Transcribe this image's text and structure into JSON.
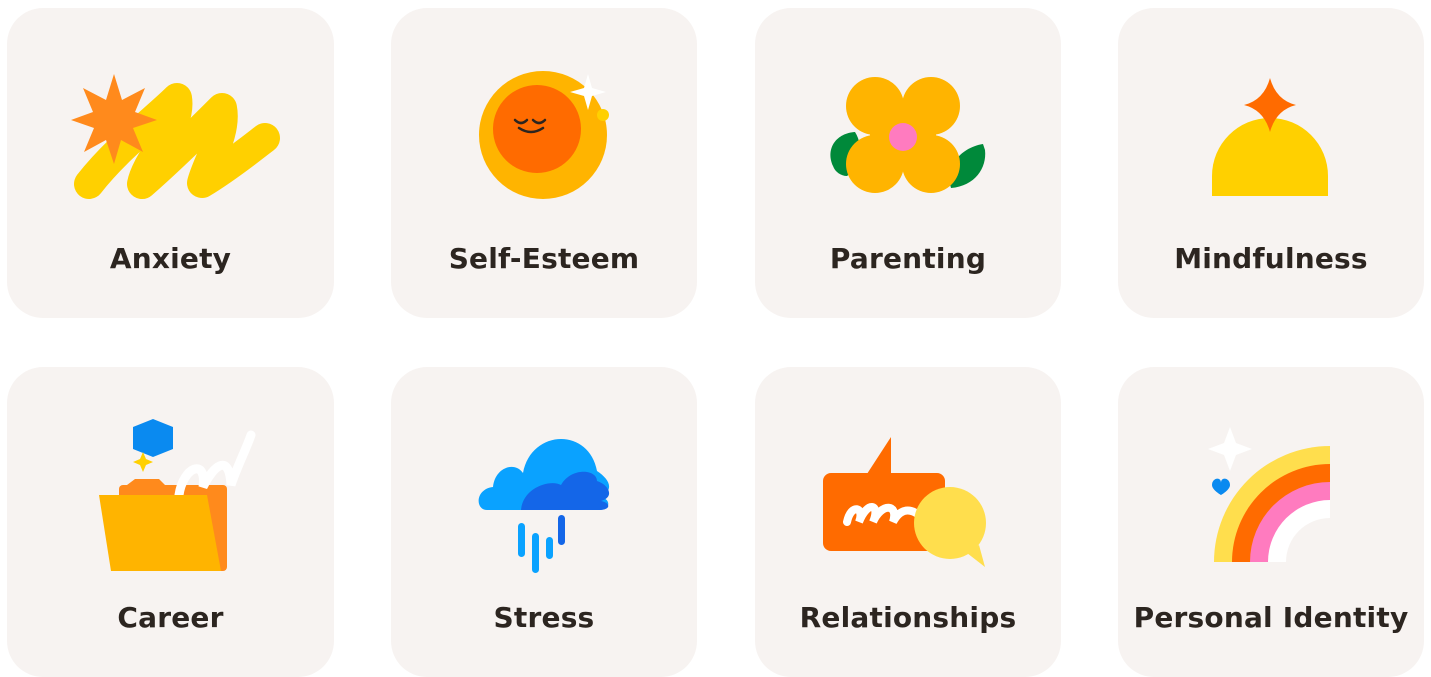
{
  "topics": [
    {
      "label": "Anxiety",
      "icon": "scribble-starburst-icon"
    },
    {
      "label": "Self-Esteem",
      "icon": "smiling-sun-icon"
    },
    {
      "label": "Parenting",
      "icon": "flower-icon"
    },
    {
      "label": "Mindfulness",
      "icon": "dome-sparkle-icon"
    },
    {
      "label": "Career",
      "icon": "folder-icon"
    },
    {
      "label": "Stress",
      "icon": "rain-cloud-icon"
    },
    {
      "label": "Relationships",
      "icon": "speech-bubbles-icon"
    },
    {
      "label": "Personal Identity",
      "icon": "rainbow-icon"
    }
  ],
  "colors": {
    "card_background": "#f7f3f1",
    "label_text": "#2c2520",
    "yellow": "#ffd000",
    "orange": "#ff6b00",
    "gold": "#ffb400",
    "green": "#00893a",
    "pink": "#ff7bbf",
    "blue": "#0a8af0"
  }
}
